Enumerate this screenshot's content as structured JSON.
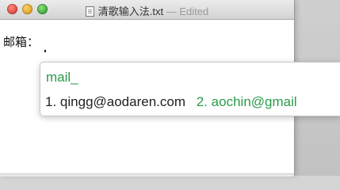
{
  "window": {
    "title": "清歌输入法.txt",
    "status": "— Edited"
  },
  "document": {
    "text": "邮箱："
  },
  "input_method": {
    "composition": "mail_",
    "candidates": [
      {
        "index": "1.",
        "text": "qingg@aodaren.com"
      },
      {
        "index": "2.",
        "text": "aochin@gmail"
      }
    ]
  }
}
